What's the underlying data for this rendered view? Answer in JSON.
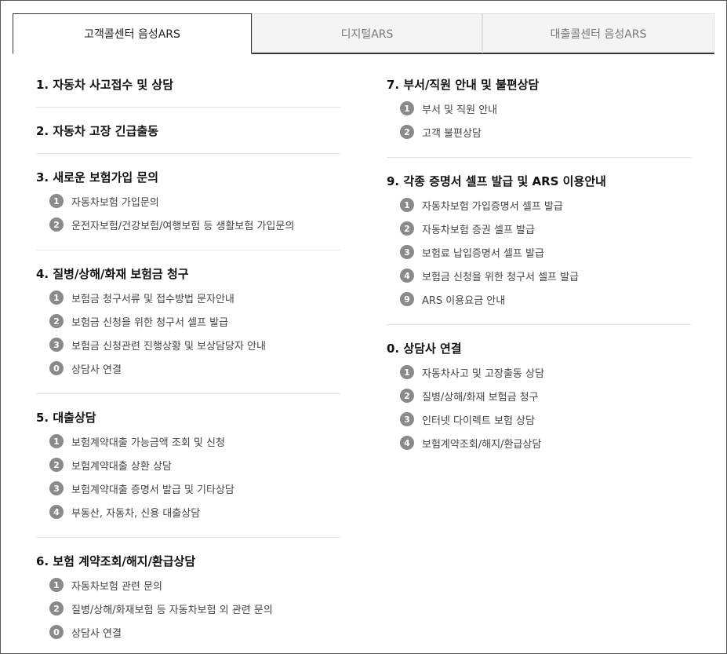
{
  "tabs": [
    {
      "label": "고객콜센터 음성ARS",
      "active": true
    },
    {
      "label": "디지털ARS",
      "active": false
    },
    {
      "label": "대출콜센터 음성ARS",
      "active": false
    }
  ],
  "colors": {
    "badge": "#8a8a8a",
    "divider": "#e3e3e3",
    "tab_inactive_bg": "#f4f4f4"
  },
  "left_sections": [
    {
      "title": "1. 자동차 사고접수 및 상담",
      "items": []
    },
    {
      "title": "2. 자동차 고장 긴급출동",
      "items": []
    },
    {
      "title": "3. 새로운 보험가입 문의",
      "items": [
        {
          "num": "1",
          "label": "자동차보험 가입문의"
        },
        {
          "num": "2",
          "label": "운전자보험/건강보험/여행보험 등 생활보험 가입문의"
        }
      ]
    },
    {
      "title": "4. 질병/상해/화재 보험금 청구",
      "items": [
        {
          "num": "1",
          "label": "보험금 청구서류 및 접수방법 문자안내"
        },
        {
          "num": "2",
          "label": "보험금 신청을 위한 청구서 셀프 발급"
        },
        {
          "num": "3",
          "label": "보험금 신청관련 진행상황 및 보상담당자 안내"
        },
        {
          "num": "0",
          "label": "상담사 연결"
        }
      ]
    },
    {
      "title": "5. 대출상담",
      "items": [
        {
          "num": "1",
          "label": "보험계약대출 가능금액 조회 및 신청"
        },
        {
          "num": "2",
          "label": "보험계약대출 상환 상담"
        },
        {
          "num": "3",
          "label": "보험계약대출 증명서 발급 및 기타상담"
        },
        {
          "num": "4",
          "label": "부동산, 자동차, 신용 대출상담"
        }
      ]
    },
    {
      "title": "6. 보험 계약조회/해지/환급상담",
      "items": [
        {
          "num": "1",
          "label": "자동차보험 관련 문의"
        },
        {
          "num": "2",
          "label": "질병/상해/화재보험 등 자동차보험 외 관련 문의"
        },
        {
          "num": "0",
          "label": "상담사 연결"
        }
      ]
    }
  ],
  "right_sections": [
    {
      "title": "7. 부서/직원 안내 및 불편상담",
      "items": [
        {
          "num": "1",
          "label": "부서 및 직원 안내"
        },
        {
          "num": "2",
          "label": "고객 불편상담"
        }
      ]
    },
    {
      "title": "9. 각종 증명서 셀프 발급 및 ARS 이용안내",
      "items": [
        {
          "num": "1",
          "label": "자동차보험 가입증명서 셀프 발급"
        },
        {
          "num": "2",
          "label": "자동차보험 증권 셀프 발급"
        },
        {
          "num": "3",
          "label": "보험료 납입증명서 셀프 발급"
        },
        {
          "num": "4",
          "label": "보험금 신청을 위한 청구서 셀프 발급"
        },
        {
          "num": "9",
          "label": "ARS 이용요금 안내"
        }
      ]
    },
    {
      "title": "0. 상담사 연결",
      "items": [
        {
          "num": "1",
          "label": "자동차사고 및 고장출동 상담"
        },
        {
          "num": "2",
          "label": "질병/상해/화재 보험금 청구"
        },
        {
          "num": "3",
          "label": "인터넷 다이렉트 보험 상담"
        },
        {
          "num": "4",
          "label": "보험계약조회/해지/환급상담"
        }
      ]
    }
  ]
}
